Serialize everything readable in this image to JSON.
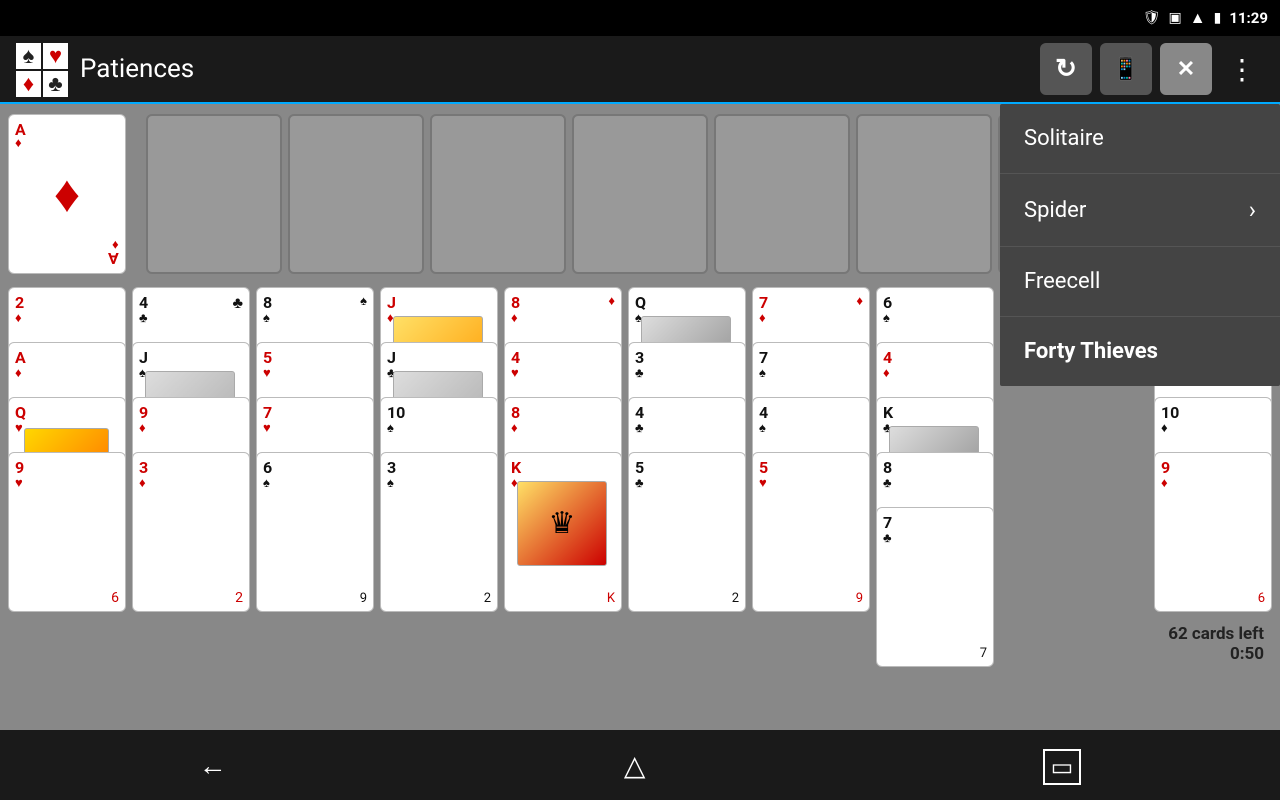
{
  "statusBar": {
    "time": "11:29",
    "battery": "🔋",
    "wifi": "WiFi"
  },
  "topBar": {
    "title": "Patiences",
    "logo": {
      "suits": [
        "♠",
        "♥",
        "♦",
        "♣"
      ]
    },
    "buttons": {
      "refresh": "↻",
      "phone": "📱",
      "close": "✕",
      "more": "⋮"
    }
  },
  "menu": {
    "items": [
      {
        "label": "Solitaire",
        "selected": false
      },
      {
        "label": "Spider",
        "selected": false
      },
      {
        "label": "Freecell",
        "selected": false
      },
      {
        "label": "Forty Thieves",
        "selected": true
      }
    ]
  },
  "gameStatus": {
    "cardsLeft": "62 cards left",
    "time": "0:50"
  },
  "navBar": {
    "back": "←",
    "home": "⌂",
    "recent": "▭"
  }
}
